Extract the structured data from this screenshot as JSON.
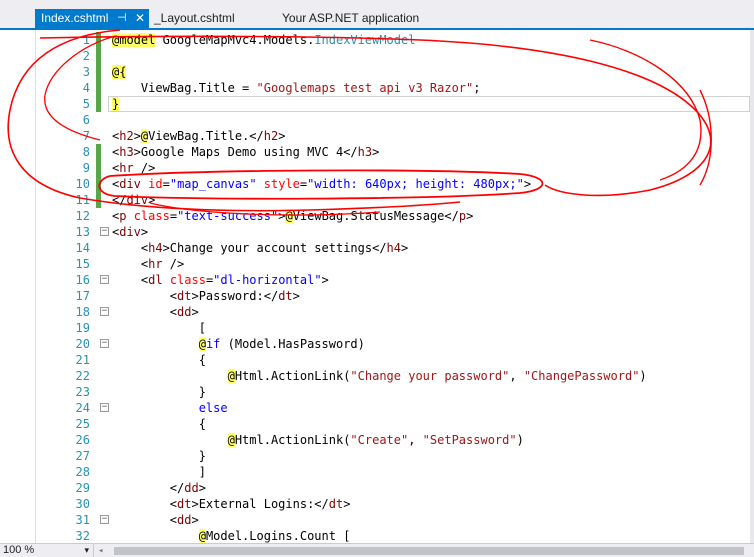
{
  "tabs": [
    {
      "label": "Index.cshtml",
      "active": true,
      "pin": "⊣",
      "close": "✕"
    },
    {
      "label": "_Layout.cshtml",
      "active": false
    },
    {
      "label": "Your ASP.NET application",
      "active": false
    }
  ],
  "lines": [
    {
      "n": "1",
      "changed": true,
      "fold": "",
      "spans": [
        [
          "rz",
          "@model"
        ],
        [
          "tx",
          " GoogleMapMvc4.Models."
        ],
        [
          "ty",
          "IndexViewModel"
        ]
      ]
    },
    {
      "n": "2",
      "changed": true,
      "fold": "",
      "spans": []
    },
    {
      "n": "3",
      "changed": true,
      "fold": "",
      "spans": [
        [
          "rz",
          "@{"
        ]
      ]
    },
    {
      "n": "4",
      "changed": true,
      "fold": "",
      "spans": [
        [
          "tx",
          "    ViewBag.Title = "
        ],
        [
          "st",
          "\"Googlemaps test api v3 Razor\""
        ],
        [
          "tx",
          ";"
        ]
      ]
    },
    {
      "n": "5",
      "changed": true,
      "fold": "",
      "current": true,
      "spans": [
        [
          "rz",
          "}"
        ]
      ]
    },
    {
      "n": "6",
      "changed": false,
      "fold": "",
      "spans": []
    },
    {
      "n": "7",
      "changed": false,
      "fold": "",
      "spans": [
        [
          "tx",
          "<"
        ],
        [
          "tg",
          "h2"
        ],
        [
          "tx",
          ">"
        ],
        [
          "rz",
          "@"
        ],
        [
          "tx",
          "ViewBag.Title.</"
        ],
        [
          "tg",
          "h2"
        ],
        [
          "tx",
          ">"
        ]
      ]
    },
    {
      "n": "8",
      "changed": true,
      "fold": "",
      "spans": [
        [
          "tx",
          "<"
        ],
        [
          "tg",
          "h3"
        ],
        [
          "tx",
          ">Google Maps Demo using MVC 4</"
        ],
        [
          "tg",
          "h3"
        ],
        [
          "tx",
          ">"
        ]
      ]
    },
    {
      "n": "9",
      "changed": true,
      "fold": "",
      "spans": [
        [
          "tx",
          "<"
        ],
        [
          "tg",
          "hr"
        ],
        [
          "tx",
          " />"
        ]
      ]
    },
    {
      "n": "10",
      "changed": true,
      "fold": "",
      "spans": [
        [
          "tx",
          "<"
        ],
        [
          "tg",
          "div"
        ],
        [
          "tx",
          " "
        ],
        [
          "at",
          "id"
        ],
        [
          "tx",
          "="
        ],
        [
          "av",
          "\"map_canvas\""
        ],
        [
          "tx",
          " "
        ],
        [
          "at",
          "style"
        ],
        [
          "tx",
          "="
        ],
        [
          "av",
          "\"width: 640px; height: 480px;\""
        ],
        [
          "tx",
          ">"
        ]
      ]
    },
    {
      "n": "11",
      "changed": true,
      "fold": "",
      "spans": [
        [
          "tx",
          "</"
        ],
        [
          "tg",
          "div"
        ],
        [
          "tx",
          ">"
        ]
      ]
    },
    {
      "n": "12",
      "changed": false,
      "fold": "",
      "spans": [
        [
          "tx",
          "<"
        ],
        [
          "tg",
          "p"
        ],
        [
          "tx",
          " "
        ],
        [
          "at",
          "class"
        ],
        [
          "tx",
          "="
        ],
        [
          "av",
          "\"text-success\""
        ],
        [
          "tx",
          ">"
        ],
        [
          "rz",
          "@"
        ],
        [
          "tx",
          "ViewBag.StatusMessage</"
        ],
        [
          "tg",
          "p"
        ],
        [
          "tx",
          ">"
        ]
      ]
    },
    {
      "n": "13",
      "changed": false,
      "fold": "−",
      "spans": [
        [
          "tx",
          "<"
        ],
        [
          "tg",
          "div"
        ],
        [
          "tx",
          ">"
        ]
      ]
    },
    {
      "n": "14",
      "changed": false,
      "fold": "",
      "spans": [
        [
          "tx",
          "    <"
        ],
        [
          "tg",
          "h4"
        ],
        [
          "tx",
          ">Change your account settings</"
        ],
        [
          "tg",
          "h4"
        ],
        [
          "tx",
          ">"
        ]
      ]
    },
    {
      "n": "15",
      "changed": false,
      "fold": "",
      "spans": [
        [
          "tx",
          "    <"
        ],
        [
          "tg",
          "hr"
        ],
        [
          "tx",
          " />"
        ]
      ]
    },
    {
      "n": "16",
      "changed": false,
      "fold": "−",
      "spans": [
        [
          "tx",
          "    <"
        ],
        [
          "tg",
          "dl"
        ],
        [
          "tx",
          " "
        ],
        [
          "at",
          "class"
        ],
        [
          "tx",
          "="
        ],
        [
          "av",
          "\"dl-horizontal\""
        ],
        [
          "tx",
          ">"
        ]
      ]
    },
    {
      "n": "17",
      "changed": false,
      "fold": "",
      "spans": [
        [
          "tx",
          "        <"
        ],
        [
          "tg",
          "dt"
        ],
        [
          "tx",
          ">Password:</"
        ],
        [
          "tg",
          "dt"
        ],
        [
          "tx",
          ">"
        ]
      ]
    },
    {
      "n": "18",
      "changed": false,
      "fold": "−",
      "spans": [
        [
          "tx",
          "        <"
        ],
        [
          "tg",
          "dd"
        ],
        [
          "tx",
          ">"
        ]
      ]
    },
    {
      "n": "19",
      "changed": false,
      "fold": "",
      "spans": [
        [
          "tx",
          "            ["
        ]
      ]
    },
    {
      "n": "20",
      "changed": false,
      "fold": "−",
      "spans": [
        [
          "tx",
          "            "
        ],
        [
          "rz",
          "@"
        ],
        [
          "kw",
          "if"
        ],
        [
          "tx",
          " (Model.HasPassword)"
        ]
      ]
    },
    {
      "n": "21",
      "changed": false,
      "fold": "",
      "spans": [
        [
          "tx",
          "            {"
        ]
      ]
    },
    {
      "n": "22",
      "changed": false,
      "fold": "",
      "spans": [
        [
          "tx",
          "                "
        ],
        [
          "rz",
          "@"
        ],
        [
          "tx",
          "Html.ActionLink("
        ],
        [
          "st",
          "\"Change your password\""
        ],
        [
          "tx",
          ", "
        ],
        [
          "st",
          "\"ChangePassword\""
        ],
        [
          "tx",
          ")"
        ]
      ]
    },
    {
      "n": "23",
      "changed": false,
      "fold": "",
      "spans": [
        [
          "tx",
          "            }"
        ]
      ]
    },
    {
      "n": "24",
      "changed": false,
      "fold": "−",
      "spans": [
        [
          "tx",
          "            "
        ],
        [
          "kw",
          "else"
        ]
      ]
    },
    {
      "n": "25",
      "changed": false,
      "fold": "",
      "spans": [
        [
          "tx",
          "            {"
        ]
      ]
    },
    {
      "n": "26",
      "changed": false,
      "fold": "",
      "spans": [
        [
          "tx",
          "                "
        ],
        [
          "rz",
          "@"
        ],
        [
          "tx",
          "Html.ActionLink("
        ],
        [
          "st",
          "\"Create\""
        ],
        [
          "tx",
          ", "
        ],
        [
          "st",
          "\"SetPassword\""
        ],
        [
          "tx",
          ")"
        ]
      ]
    },
    {
      "n": "27",
      "changed": false,
      "fold": "",
      "spans": [
        [
          "tx",
          "            }"
        ]
      ]
    },
    {
      "n": "28",
      "changed": false,
      "fold": "",
      "spans": [
        [
          "tx",
          "            ]"
        ]
      ]
    },
    {
      "n": "29",
      "changed": false,
      "fold": "",
      "spans": [
        [
          "tx",
          "        </"
        ],
        [
          "tg",
          "dd"
        ],
        [
          "tx",
          ">"
        ]
      ]
    },
    {
      "n": "30",
      "changed": false,
      "fold": "",
      "spans": [
        [
          "tx",
          "        <"
        ],
        [
          "tg",
          "dt"
        ],
        [
          "tx",
          ">External Logins:</"
        ],
        [
          "tg",
          "dt"
        ],
        [
          "tx",
          ">"
        ]
      ]
    },
    {
      "n": "31",
      "changed": false,
      "fold": "−",
      "spans": [
        [
          "tx",
          "        <"
        ],
        [
          "tg",
          "dd"
        ],
        [
          "tx",
          ">"
        ]
      ]
    },
    {
      "n": "32",
      "changed": false,
      "fold": "",
      "spans": [
        [
          "tx",
          "            "
        ],
        [
          "rz",
          "@"
        ],
        [
          "tx",
          "Model.Logins.Count ["
        ]
      ]
    }
  ],
  "status": {
    "zoom": "100 %",
    "zoom_arrow": "▾",
    "scroll_left": "◂"
  },
  "colors": {
    "accent": "#007acc",
    "annotation": "#ff0000",
    "changed_marker": "#57a64a",
    "line_number": "#2b91af"
  }
}
